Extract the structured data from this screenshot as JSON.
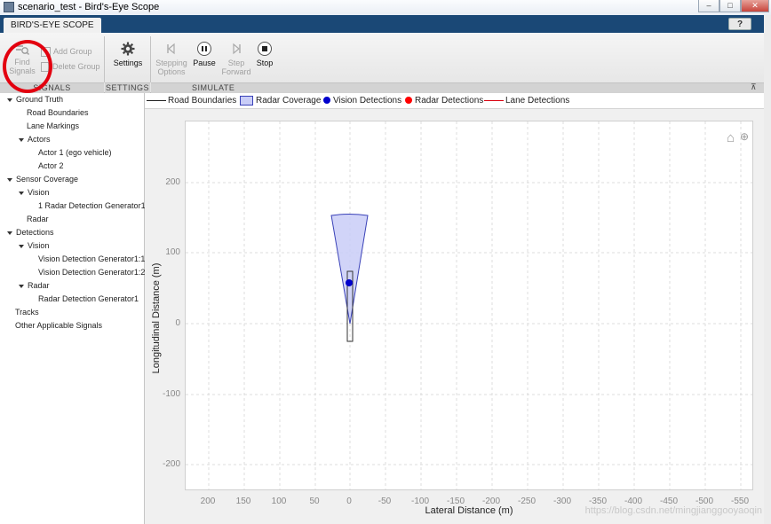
{
  "window": {
    "title": "scenario_test - Bird's-Eye Scope",
    "controls": [
      "–",
      "□",
      "✕"
    ]
  },
  "tab": {
    "label": "BIRD'S-EYE SCOPE"
  },
  "help": {
    "label": "?"
  },
  "toolstrip": {
    "find_signals": "Find Signals",
    "add_group": "Add Group",
    "delete_group": "Delete Group",
    "settings": "Settings",
    "stepping_options": "Stepping Options",
    "pause": "Pause",
    "step_forward": "Step Forward",
    "stop": "Stop",
    "sections": {
      "signals": "SIGNALS",
      "settings": "SETTINGS",
      "simulate": "SIMULATE"
    }
  },
  "tree": {
    "items": [
      {
        "label": "Ground Truth",
        "expanded": true
      },
      {
        "label": "Road Boundaries"
      },
      {
        "label": "Lane Markings"
      },
      {
        "label": "Actors",
        "expanded": true
      },
      {
        "label": "Actor 1 (ego vehicle)"
      },
      {
        "label": "Actor 2"
      },
      {
        "label": "Sensor Coverage",
        "expanded": true
      },
      {
        "label": "Vision",
        "expanded": true
      },
      {
        "label": "1 Radar Detection Generator1"
      },
      {
        "label": "Radar"
      },
      {
        "label": "Detections",
        "expanded": true
      },
      {
        "label": "Vision",
        "expanded": true
      },
      {
        "label": "Vision Detection Generator1:1"
      },
      {
        "label": "Vision Detection Generator1:2"
      },
      {
        "label": "Radar",
        "expanded": true
      },
      {
        "label": "Radar Detection Generator1"
      },
      {
        "label": "Tracks"
      },
      {
        "label": "Other Applicable Signals"
      }
    ]
  },
  "legend": {
    "road_boundaries": "Road Boundaries",
    "radar_coverage": "Radar Coverage",
    "vision_detections": "Vision Detections",
    "radar_detections": "Radar Detections",
    "lane_detections": "Lane Detections"
  },
  "plot": {
    "xlabel": "Lateral Distance (m)",
    "ylabel": "Longitudinal Distance (m)",
    "x_ticks": [
      "200",
      "150",
      "100",
      "50",
      "0",
      "-50",
      "-100",
      "-150",
      "-200",
      "-250",
      "-300",
      "-350",
      "-400",
      "-450",
      "-500",
      "-550"
    ],
    "y_ticks": [
      "200",
      "100",
      "0",
      "-100",
      "-200"
    ]
  },
  "watermark": "https://blog.csdn.net/mingjianggooyaoqin",
  "colors": {
    "titlebar_blue": "#1a4876",
    "vision_detection": "#0000cc",
    "radar_detection": "#ff0000",
    "lane_detection": "#d9000e",
    "coverage_fill": "#c9cdf7",
    "annotation": "#e3000f"
  }
}
